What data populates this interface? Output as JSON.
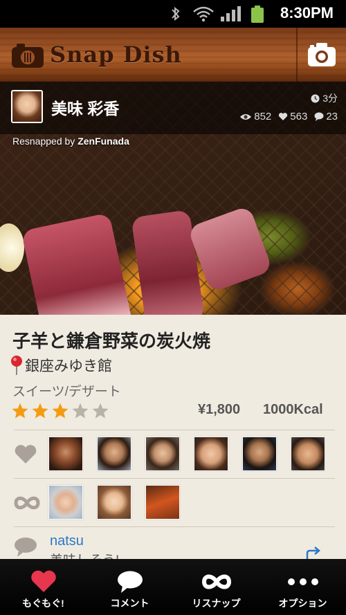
{
  "status_bar": {
    "time": "8:30PM",
    "icons": [
      "bluetooth-icon",
      "wifi-icon",
      "signal-icon",
      "battery-icon"
    ]
  },
  "header": {
    "app_name": "Snap Dish",
    "icons": [
      "snapdish-logo-icon",
      "camera-icon"
    ]
  },
  "post": {
    "user_name": "美味 彩香",
    "time_ago": "3分",
    "views": "852",
    "likes": "563",
    "comments": "23",
    "resnapped_prefix": "Resnapped by",
    "resnapped_by": "ZenFunada"
  },
  "dish": {
    "title": "子羊と鎌倉野菜の炭火焼",
    "place": "銀座みゆき館",
    "category": "スイーツ/デザート",
    "rating": 3,
    "rating_max": 5,
    "price": "¥1,800",
    "kcal": "1000Kcal"
  },
  "comment": {
    "name": "natsu",
    "text": "美味しそう!"
  },
  "tabbar": {
    "items": [
      {
        "label": "もぐもぐ!",
        "icon": "heart-icon"
      },
      {
        "label": "コメント",
        "icon": "speech-bubble-icon"
      },
      {
        "label": "リスナップ",
        "icon": "infinity-icon"
      },
      {
        "label": "オプション",
        "icon": "more-dots-icon"
      }
    ]
  },
  "colors": {
    "accent": "#e8364f",
    "link": "#2b78c5",
    "star": "#f39c12",
    "background": "#f0ebe0"
  }
}
